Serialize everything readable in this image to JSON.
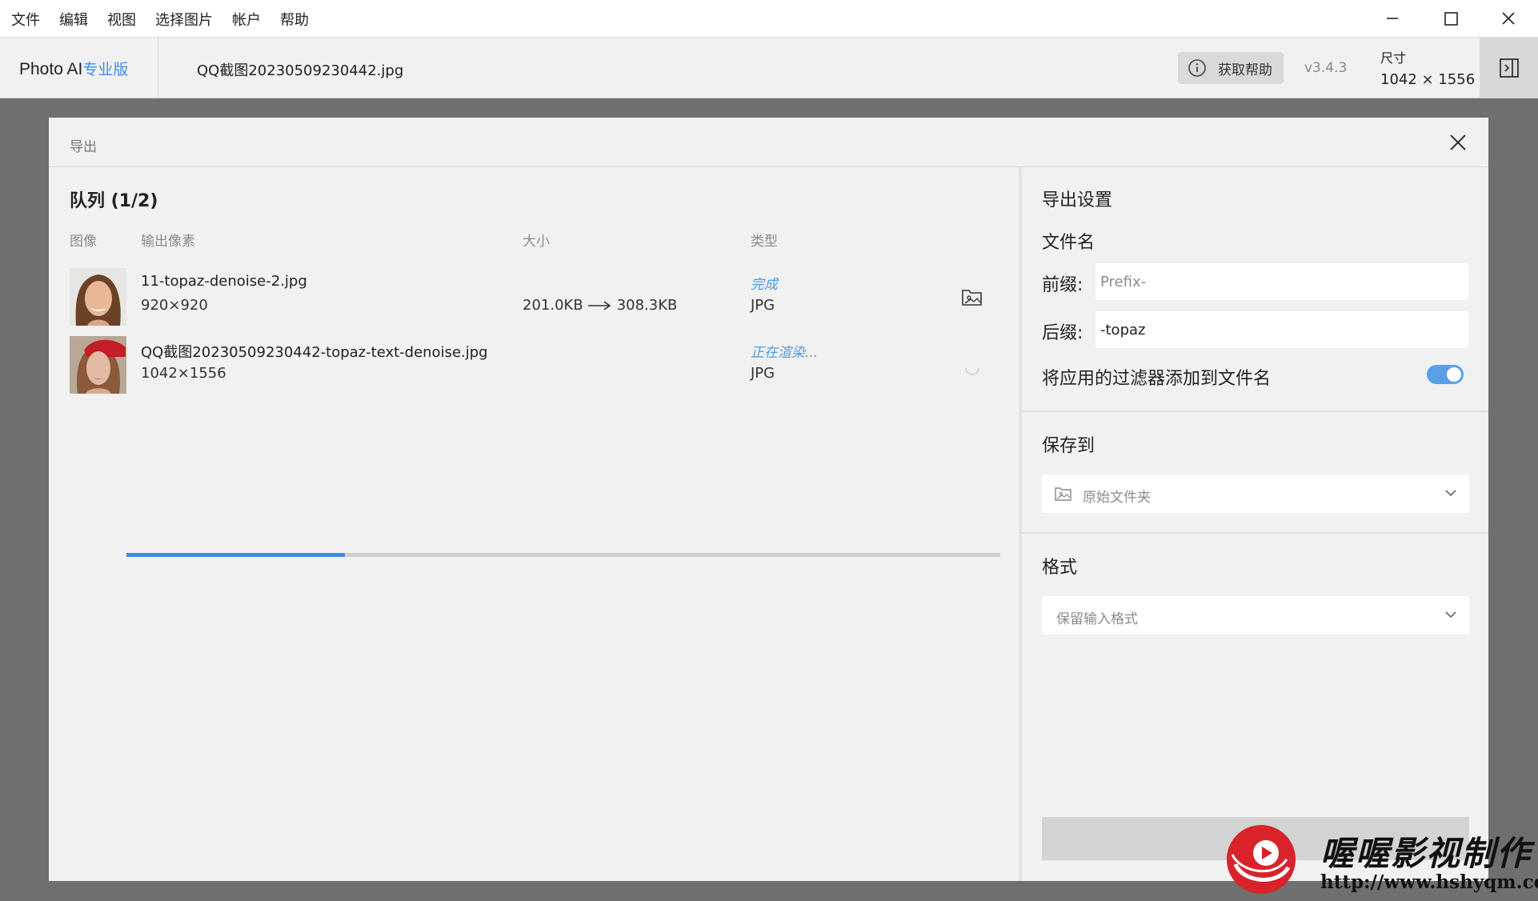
{
  "menubar": {
    "items": [
      "文件",
      "编辑",
      "视图",
      "选择图片",
      "帐户",
      "帮助"
    ]
  },
  "appbar": {
    "brand": "Photo AI",
    "brand_pro": "专业版",
    "filename": "QQ截图20230509230442.jpg",
    "help_label": "获取帮助",
    "version": "v3.4.3",
    "size_label": "尺寸",
    "size_value": "1042 × 1556"
  },
  "dialog": {
    "title": "导出",
    "queue_title": "队列 (1/2)",
    "columns": [
      "图像",
      "输出像素",
      "大小",
      "类型"
    ],
    "rows": [
      {
        "name": "11-topaz-denoise-2.jpg",
        "dims": "920×920",
        "size_from": "201.0KB",
        "size_to": "308.3KB",
        "status": "完成",
        "type": "JPG"
      },
      {
        "name": "QQ截图20230509230442-topaz-text-denoise.jpg",
        "dims": "1042×1556",
        "status": "正在渲染...",
        "type": "JPG",
        "progress": 0.25
      }
    ]
  },
  "settings": {
    "title": "导出设置",
    "filename_section": "文件名",
    "prefix_label": "前缀:",
    "prefix_placeholder": "Prefix-",
    "suffix_label": "后缀:",
    "suffix_value": "-topaz",
    "filter_toggle_label": "将应用的过滤器添加到文件名",
    "filter_toggle_on": true,
    "save_to_title": "保存到",
    "save_to_value": "原始文件夹",
    "format_title": "格式",
    "format_value": "保留输入格式",
    "accent_color": "#3b8ee6"
  },
  "watermark": {
    "name": "喔喔影视制作",
    "url": "http://www.hshyqm.com/"
  }
}
